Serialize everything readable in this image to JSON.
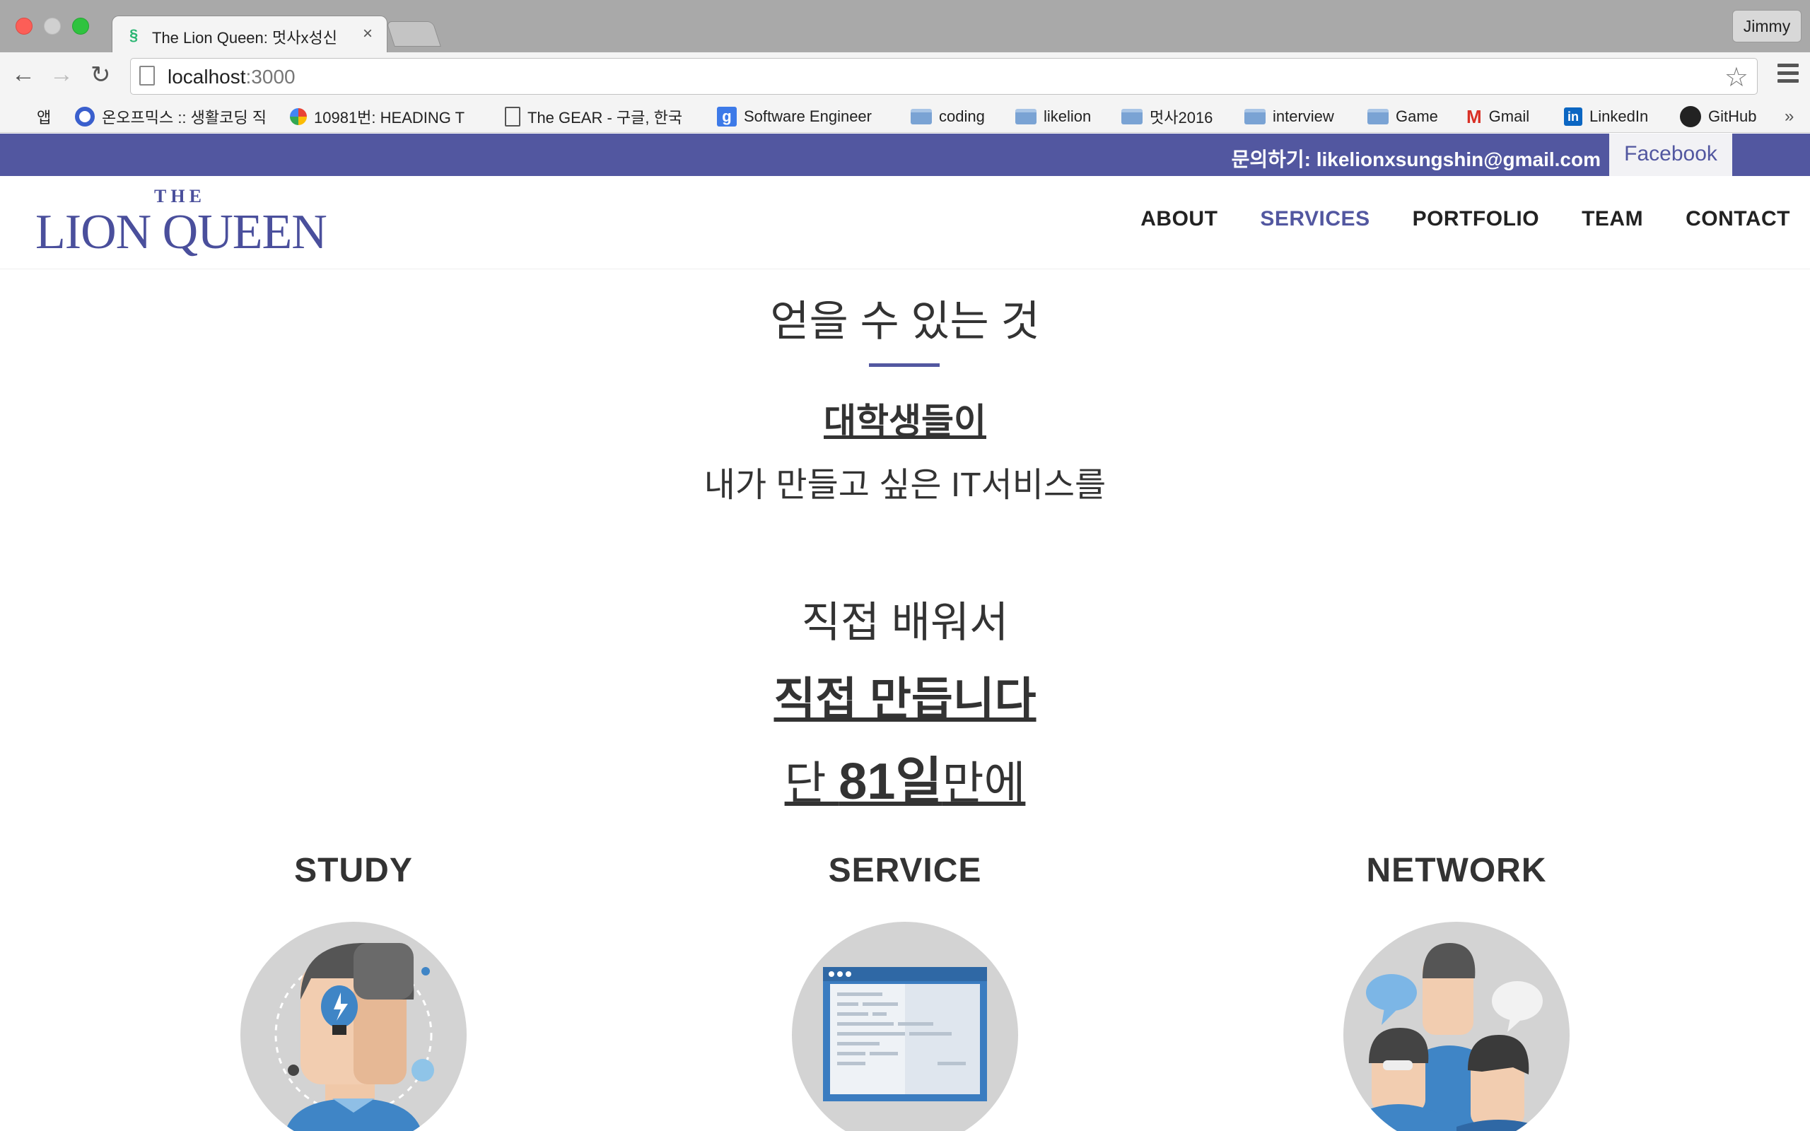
{
  "browser": {
    "tab_title": "The Lion Queen: 멋사x성신",
    "tab_close": "×",
    "profile": "Jimmy",
    "back": "←",
    "forward": "→",
    "reload": "↻",
    "url_host": "localhost",
    "url_port": ":3000",
    "star": "☆",
    "bookmarks": {
      "apps": "앱",
      "b1": "온오프믹스 :: 생활코딩 직",
      "b2": "10981번: HEADING T",
      "b3": "The GEAR - 구글, 한국",
      "b4": "Software Engineer",
      "b5": "coding",
      "b6": "likelion",
      "b7": "멋사2016",
      "b8": "interview",
      "b9": "Game",
      "b10": "Gmail",
      "b11": "LinkedIn",
      "b12": "GitHub",
      "more": "»"
    }
  },
  "topbar": {
    "contact": "문의하기: likelionxsungshin@gmail.com",
    "facebook": "Facebook"
  },
  "header": {
    "logo_the": "THE",
    "logo_name": "LION QUEEN",
    "nav": {
      "about": "ABOUT",
      "services": "SERVICES",
      "portfolio": "PORTFOLIO",
      "team": "TEAM",
      "contact": "CONTACT"
    },
    "active": "SERVICES"
  },
  "section": {
    "title": "얻을 수 있는 것",
    "line1": "대학생들이",
    "line2": "내가 만들고 싶은 IT서비스를",
    "line3": "직접 배워서",
    "line4": "직접 만듭니다",
    "line5_pre": "단 ",
    "line5_bold": "81일",
    "line5_post": "만에"
  },
  "features": {
    "study": "STUDY",
    "service": "SERVICE",
    "network": "NETWORK"
  },
  "colors": {
    "brand": "#5257a0",
    "tabbar": "#a9a9a9",
    "text": "#333333",
    "illustration_bg": "#d3d3d3"
  }
}
